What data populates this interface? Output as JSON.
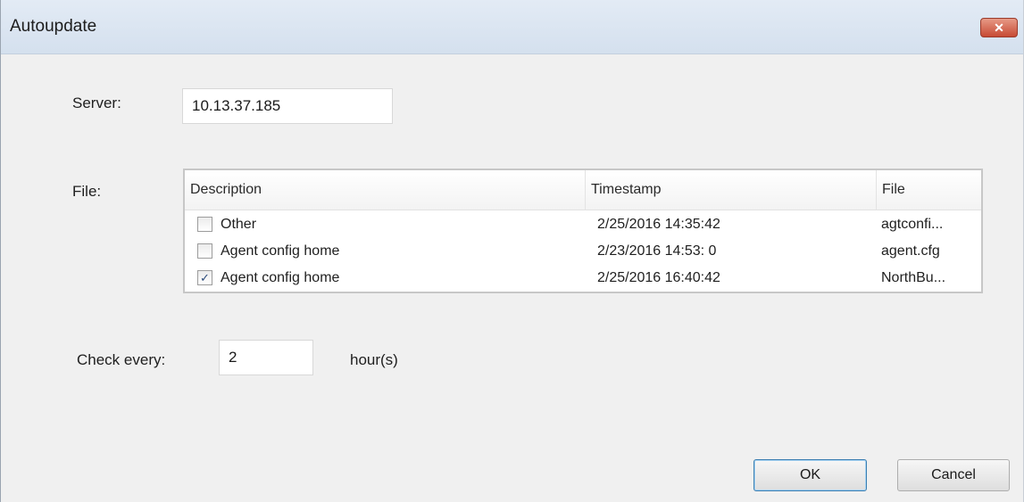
{
  "window": {
    "title": "Autoupdate",
    "close_icon": "close-x-icon"
  },
  "server": {
    "label": "Server:",
    "value": "10.13.37.185"
  },
  "file": {
    "label": "File:",
    "columns": [
      "Description",
      "Timestamp",
      "File"
    ],
    "rows": [
      {
        "checked": false,
        "description": "Other",
        "timestamp": "2/25/2016 14:35:42",
        "file": "agtconfi..."
      },
      {
        "checked": false,
        "description": "Agent config home",
        "timestamp": "2/23/2016 14:53: 0",
        "file": "agent.cfg"
      },
      {
        "checked": true,
        "description": "Agent config home",
        "timestamp": "2/25/2016 16:40:42",
        "file": "NorthBu..."
      }
    ]
  },
  "check": {
    "label": "Check every:",
    "value": "2",
    "unit": "hour(s)"
  },
  "buttons": {
    "ok": "OK",
    "cancel": "Cancel"
  }
}
